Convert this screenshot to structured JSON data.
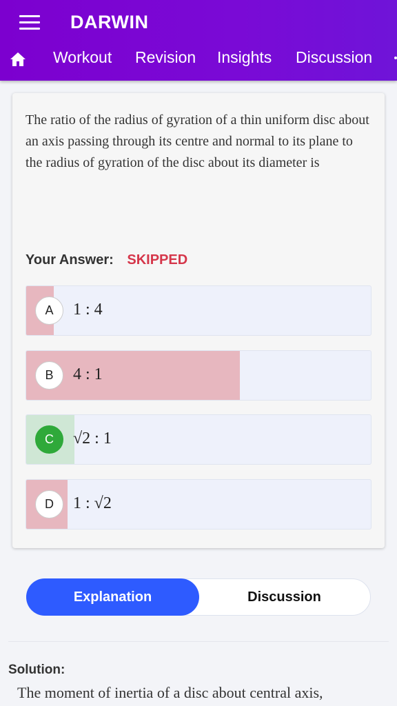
{
  "header": {
    "app_title": "DARWIN",
    "menu_icon": "hamburger-menu-icon",
    "home_icon": "home-icon",
    "tabs": [
      {
        "label": "Workout"
      },
      {
        "label": "Revision"
      },
      {
        "label": "Insights"
      },
      {
        "label": "Discussion"
      }
    ],
    "background": "#7c00cf"
  },
  "question": {
    "text": "The ratio of the radius of gyration of a thin uniform disc about an axis passing through its centre and normal to its plane to the radius of gyration of the disc about its diameter is",
    "answer_label": "Your Answer:",
    "answer_value": "SKIPPED",
    "answer_color": "#d5364a",
    "options": [
      {
        "letter": "A",
        "text": "1 : 4",
        "response_share": 0.08,
        "status": "wrong"
      },
      {
        "letter": "B",
        "text": "4 : 1",
        "response_share": 0.62,
        "status": "wrong"
      },
      {
        "letter": "C",
        "text": "√2 : 1",
        "response_share": 0.14,
        "status": "correct"
      },
      {
        "letter": "D",
        "text": "1 : √2",
        "response_share": 0.12,
        "status": "wrong"
      }
    ]
  },
  "tabs": {
    "explanation": "Explanation",
    "discussion": "Discussion",
    "active_color": "#2e5bff"
  },
  "solution": {
    "label": "Solution:",
    "text": "The moment of inertia of a disc about central axis,"
  }
}
